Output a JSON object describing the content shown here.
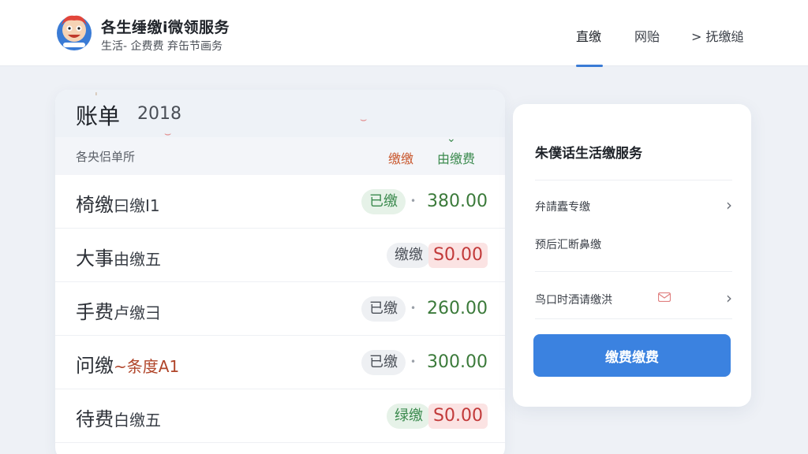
{
  "header": {
    "brand_title": "各生缍缴i微领服务",
    "brand_subtitle": "生活- 企费费 弃缶节画务",
    "nav": [
      {
        "label": "直缴"
      },
      {
        "label": "网贻"
      },
      {
        "label": "> 抚缴缒"
      }
    ]
  },
  "bill": {
    "title": "账单",
    "year": "2018",
    "column_left": "各央侣单所",
    "column_mid": "缴缴",
    "column_right": "由缴费",
    "rows": [
      {
        "name_main": "椅缴",
        "name_sub": "曰缴I1",
        "status": "已缴",
        "amount": "380.00",
        "amount_style": "green"
      },
      {
        "name_main": "大事",
        "name_sub": "由缴五",
        "status": "缴缴",
        "amount": "S0.00",
        "amount_style": "red"
      },
      {
        "name_main": "手费",
        "name_sub": "卢缴彐",
        "status": "已缴",
        "amount": "260.00",
        "amount_style": "green"
      },
      {
        "name_main": "问缴",
        "name_sub": "~条度A1",
        "status": "已缴",
        "amount": "300.00",
        "amount_style": "green"
      },
      {
        "name_main": "待费",
        "name_sub": "白缴五",
        "status": "绿缴",
        "amount": "S0.00",
        "amount_style": "red"
      }
    ]
  },
  "side": {
    "title": "朱僕话生活缴服务",
    "items": [
      {
        "label": "弁請蠹专缴"
      },
      {
        "label": "预后汇断鼻缴"
      },
      {
        "label": "鸟口时洒请缴洪"
      }
    ],
    "pay_button": "缴费缴费"
  },
  "colors": {
    "accent": "#3b82e0",
    "paid_amount": "#3b7a3a",
    "due_amount": "#c23a3a"
  }
}
